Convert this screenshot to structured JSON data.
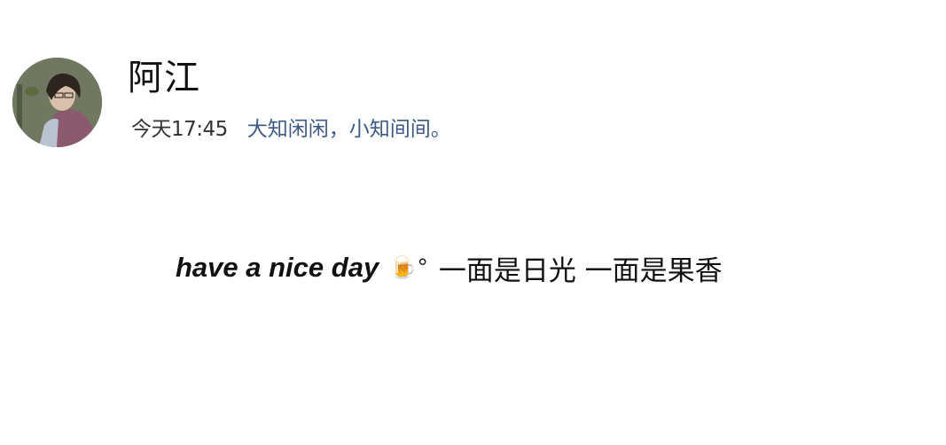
{
  "author": {
    "name": "阿江",
    "avatar_icon": "user-avatar-icon"
  },
  "meta": {
    "time": "今天17:45",
    "signature": "大知闲闲，小知间间。"
  },
  "post": {
    "greeting": "have a nice day",
    "emoji": "🍺°",
    "text": "一面是日光 一面是果香"
  },
  "colors": {
    "signature": "#3d5a86",
    "text": "#111111"
  }
}
